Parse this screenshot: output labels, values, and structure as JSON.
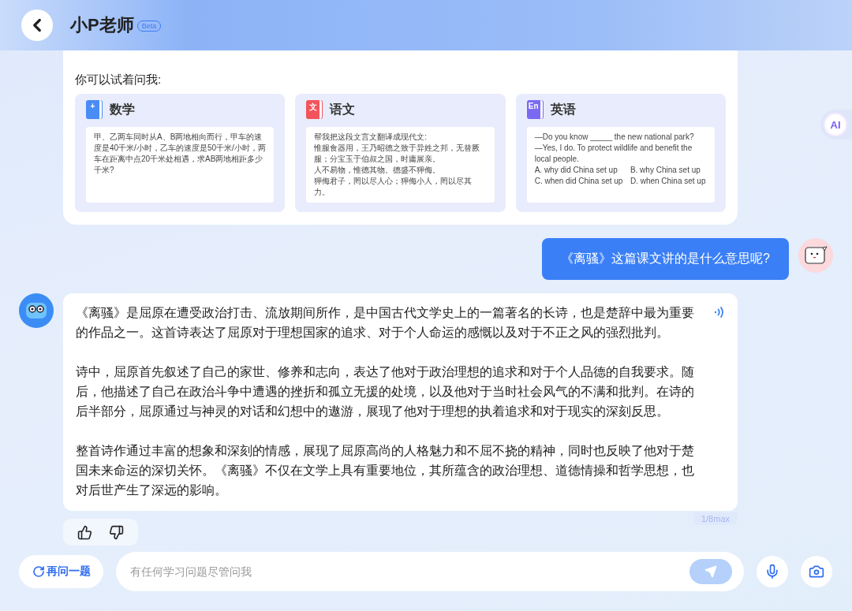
{
  "header": {
    "title": "小P老师",
    "badge": "Beta"
  },
  "ai_button": {
    "label": "AI"
  },
  "intro": {
    "prompt": "你可以试着问我:",
    "subjects": [
      {
        "kind": "math",
        "title": "数学",
        "icon_label": "+",
        "lines": [
          "甲、乙两车同时从A、B两地相向而行，甲车的速度是40千米/小时，乙车的速度是50千米/小时，两车在距离中点20千米处相遇，求AB两地相距多少千米?"
        ]
      },
      {
        "kind": "chinese",
        "title": "语文",
        "icon_label": "文",
        "lines": [
          "帮我把这段文言文翻译成现代文:",
          "惟服食器用，王乃昭德之致于异姓之邦，无替厥服；分宝玉于伯叔之国，时庸展亲。",
          "人不易物，惟德其物。德盛不狎侮。",
          "狎侮君子，罔以尽人心；狎侮小人，罔以尽其力。"
        ]
      },
      {
        "kind": "english",
        "title": "英语",
        "icon_label": "En",
        "lines": [
          "—Do you know _____ the new national park?",
          "—Yes, I do. To protect wildlife and benefit the local people."
        ],
        "options": [
          "A. why did China set up",
          "B. why China set up",
          "C. when did China set up",
          "D. when China set up"
        ]
      }
    ]
  },
  "user_message": {
    "text": "《离骚》这篇课文讲的是什么意思呢?"
  },
  "answer": {
    "paragraphs": [
      "《离骚》是屈原在遭受政治打击、流放期间所作，是中国古代文学史上的一篇著名的长诗，也是楚辞中最为重要的作品之一。这首诗表达了屈原对于理想国家的追求、对于个人命运的感慨以及对于不正之风的强烈批判。",
      "诗中，屈原首先叙述了自己的家世、修养和志向，表达了他对于政治理想的追求和对于个人品德的自我要求。随后，他描述了自己在政治斗争中遭遇的挫折和孤立无援的处境，以及他对于当时社会风气的不满和批判。在诗的后半部分，屈原通过与神灵的对话和幻想中的遨游，展现了他对于理想的执着追求和对于现实的深刻反思。",
      "整首诗作通过丰富的想象和深刻的情感，展现了屈原高尚的人格魅力和不屈不挠的精神，同时也反映了他对于楚国未来命运的深切关怀。《离骚》不仅在文学上具有重要地位，其所蕴含的政治理想、道德情操和哲学思想，也对后世产生了深远的影响。"
    ],
    "counter": "1/8max"
  },
  "bottom_bar": {
    "reask": "再问一题",
    "input": {
      "placeholder": "有任何学习问题尽管问我",
      "send_disabled": true
    }
  }
}
